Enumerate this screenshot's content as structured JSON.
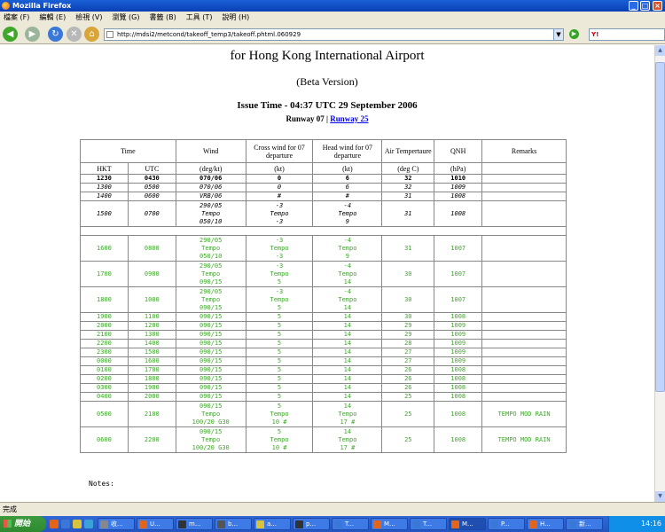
{
  "window": {
    "title": "Mozilla Firefox",
    "minimize": "_",
    "maximize": "□",
    "close": "×"
  },
  "menu": [
    "檔案 (F)",
    "編輯 (E)",
    "檢視 (V)",
    "瀏覽 (G)",
    "書籤 (B)",
    "工具 (T)",
    "說明 (H)"
  ],
  "nav": {
    "url": "http://mdsi2/metcond/takeoff_temp3/takeoff.phtml.060929",
    "back": "◀",
    "fwd": "▶",
    "reload": "↻",
    "stop": "✕",
    "home": "⌂",
    "go": "▶",
    "search_brand": "Y!"
  },
  "page": {
    "title": "for Hong Kong International Airport",
    "subtitle": "(Beta Version)",
    "issue": "Issue Time - 04:37 UTC 29 September 2006",
    "runway_prefix": "Runway 07 | ",
    "runway_link": "Runway 25",
    "notes": "Notes:"
  },
  "table": {
    "headers": {
      "time": "Time",
      "wind": "Wind",
      "cross": "Cross wind for 07 departure",
      "head": "Head wind for 07 departure",
      "temp": "Air Tempertaure",
      "qnh": "QNH",
      "remarks": "Remarks"
    },
    "subheaders": {
      "hkt": "HKT",
      "utc": "UTC",
      "wind": "(deg/kt)",
      "cross": "(kt)",
      "head": "(kt)",
      "temp": "(deg C)",
      "qnh": "(hPa)"
    },
    "rows": [
      {
        "style": "b",
        "hkt": "1230",
        "utc": "0430",
        "wind": "070/06",
        "cross": "0",
        "head": "6",
        "temp": "32",
        "qnh": "1010",
        "rem": ""
      },
      {
        "style": "i",
        "hkt": "1300",
        "utc": "0500",
        "wind": "070/06",
        "cross": "0",
        "head": "6",
        "temp": "32",
        "qnh": "1009",
        "rem": ""
      },
      {
        "style": "i",
        "hkt": "1400",
        "utc": "0600",
        "wind": "VRB/06",
        "cross": "#",
        "head": "#",
        "temp": "31",
        "qnh": "1008",
        "rem": ""
      },
      {
        "style": "i",
        "hkt": "1500",
        "utc": "0700",
        "wind": "290/05\nTempo\n050/10",
        "cross": "-3\nTempo\n-3",
        "head": "-4\nTempo\n9",
        "temp": "31",
        "qnh": "1008",
        "rem": ""
      },
      {
        "style": "sep"
      },
      {
        "style": "g",
        "hkt": "1600",
        "utc": "0800",
        "wind": "290/05\nTempo\n050/10",
        "cross": "-3\nTempo\n-3",
        "head": "-4\nTempo\n9",
        "temp": "31",
        "qnh": "1007",
        "rem": ""
      },
      {
        "style": "g",
        "hkt": "1700",
        "utc": "0900",
        "wind": "290/05\nTempo\n090/15",
        "cross": "-3\nTempo\n5",
        "head": "-4\nTempo\n14",
        "temp": "30",
        "qnh": "1007",
        "rem": ""
      },
      {
        "style": "g",
        "hkt": "1800",
        "utc": "1000",
        "wind": "290/05\nTempo\n090/15",
        "cross": "-3\nTempo\n5",
        "head": "-4\nTempo\n14",
        "temp": "30",
        "qnh": "1007",
        "rem": ""
      },
      {
        "style": "g",
        "hkt": "1900",
        "utc": "1100",
        "wind": "090/15",
        "cross": "5",
        "head": "14",
        "temp": "30",
        "qnh": "1008",
        "rem": ""
      },
      {
        "style": "g",
        "hkt": "2000",
        "utc": "1200",
        "wind": "090/15",
        "cross": "5",
        "head": "14",
        "temp": "29",
        "qnh": "1009",
        "rem": ""
      },
      {
        "style": "g",
        "hkt": "2100",
        "utc": "1300",
        "wind": "090/15",
        "cross": "5",
        "head": "14",
        "temp": "29",
        "qnh": "1009",
        "rem": ""
      },
      {
        "style": "g",
        "hkt": "2200",
        "utc": "1400",
        "wind": "090/15",
        "cross": "5",
        "head": "14",
        "temp": "28",
        "qnh": "1009",
        "rem": ""
      },
      {
        "style": "g",
        "hkt": "2300",
        "utc": "1500",
        "wind": "090/15",
        "cross": "5",
        "head": "14",
        "temp": "27",
        "qnh": "1009",
        "rem": ""
      },
      {
        "style": "g",
        "hkt": "0000",
        "utc": "1600",
        "wind": "090/15",
        "cross": "5",
        "head": "14",
        "temp": "27",
        "qnh": "1009",
        "rem": ""
      },
      {
        "style": "g",
        "hkt": "0100",
        "utc": "1700",
        "wind": "090/15",
        "cross": "5",
        "head": "14",
        "temp": "26",
        "qnh": "1008",
        "rem": ""
      },
      {
        "style": "g",
        "hkt": "0200",
        "utc": "1800",
        "wind": "090/15",
        "cross": "5",
        "head": "14",
        "temp": "26",
        "qnh": "1008",
        "rem": ""
      },
      {
        "style": "g",
        "hkt": "0300",
        "utc": "1900",
        "wind": "090/15",
        "cross": "5",
        "head": "14",
        "temp": "26",
        "qnh": "1008",
        "rem": ""
      },
      {
        "style": "g",
        "hkt": "0400",
        "utc": "2000",
        "wind": "090/15",
        "cross": "5",
        "head": "14",
        "temp": "25",
        "qnh": "1008",
        "rem": ""
      },
      {
        "style": "g",
        "hkt": "0500",
        "utc": "2100",
        "wind": "090/15\nTempo\n100/20 G30",
        "cross": "5\nTempo\n10 #",
        "head": "14\nTempo\n17 #",
        "temp": "25",
        "qnh": "1008",
        "rem": "TEMPO MOD RAIN"
      },
      {
        "style": "g",
        "hkt": "0600",
        "utc": "2200",
        "wind": "090/15\nTempo\n100/20 G30",
        "cross": "5\nTempo\n10 #",
        "head": "14\nTempo\n17 #",
        "temp": "25",
        "qnh": "1008",
        "rem": "TEMPO MOD RAIN"
      }
    ]
  },
  "status": "完成",
  "taskbar": {
    "start": "開始",
    "clock": "14:16",
    "tasks": [
      "收...",
      "U...",
      "m...",
      "b...",
      "a...",
      "p...",
      "T...",
      "M...",
      "T...",
      "M...",
      "P...",
      "H...",
      "新..."
    ]
  },
  "colors": {
    "green": "#3fa82a",
    "link": "#0000ee",
    "titlebar": "#0a3fb5"
  }
}
